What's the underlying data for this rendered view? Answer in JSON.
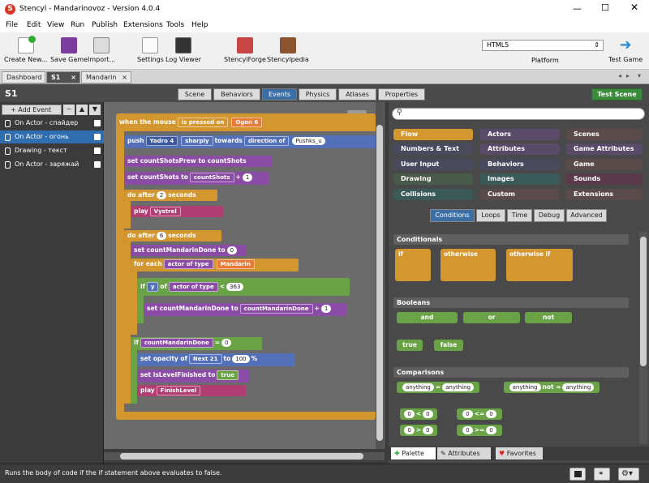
{
  "window": {
    "title": "Stencyl - Mandarinovoz - Version 4.0.4"
  },
  "menu": [
    "File",
    "Edit",
    "View",
    "Run",
    "Publish",
    "Extensions",
    "Tools",
    "Help"
  ],
  "toolbar": {
    "create_new": "Create New...",
    "save_game": "Save Game",
    "import": "Import...",
    "settings": "Settings",
    "log_viewer": "Log Viewer",
    "stencylforge": "StencylForge",
    "stencylpedia": "Stencylpedia",
    "platform_value": "HTML5",
    "platform_label": "Platform",
    "test_game": "Test Game"
  },
  "tabs": {
    "dashboard": "Dashboard",
    "s1": "S1",
    "mandarin": "Mandarin"
  },
  "scene_title": "S1",
  "modes": [
    "Scene",
    "Behaviors",
    "Events",
    "Physics",
    "Atlases",
    "Properties"
  ],
  "test_scene": "Test Scene",
  "events": {
    "add_event": "+ Add Event",
    "items": [
      "On Actor - спайдер",
      "On Actor - огонь",
      "Drawing - текст",
      "On Actor - заряжай"
    ]
  },
  "blocks": {
    "when_pressed": [
      "when the mouse",
      "is pressed on",
      "Ogon 6"
    ],
    "push": [
      "push",
      "Yadro 4",
      "sharply",
      "towards",
      "direction of",
      "Pushks_u"
    ],
    "set1": [
      "set countShotsPrew to",
      "countShots"
    ],
    "set2": [
      "set countShots to",
      "countShots",
      "+",
      "1"
    ],
    "do_after1": [
      "do after",
      "2",
      "seconds"
    ],
    "play1": [
      "play",
      "Vystrel"
    ],
    "do_after2": [
      "do after",
      "6",
      "seconds"
    ],
    "set3": [
      "set countMandarinDone to",
      "0"
    ],
    "for_each": [
      "for each",
      "actor of type",
      "Mandarin"
    ],
    "if1": [
      "if",
      "y",
      "of",
      "actor of type",
      "<",
      "363"
    ],
    "set4": [
      "set countMandarinDone to",
      "countMandarinDone",
      "+",
      "1"
    ],
    "if2": [
      "if",
      "countMandarinDone",
      "=",
      "0"
    ],
    "opacity": [
      "set opacity of",
      "Next 21",
      "to",
      "100",
      "%"
    ],
    "level": [
      "set isLevelFinished to",
      "true"
    ],
    "play2": [
      "play",
      "FinishLevel"
    ]
  },
  "palette": {
    "search_placeholder": "",
    "categories": [
      "Flow",
      "Actors",
      "Scenes",
      "Numbers & Text",
      "Attributes",
      "Game Attributes",
      "User Input",
      "Behaviors",
      "Game",
      "Drawing",
      "Images",
      "Sounds",
      "Collisions",
      "Custom",
      "Extensions"
    ],
    "subtabs": [
      "Conditions",
      "Loops",
      "Time",
      "Debug",
      "Advanced"
    ],
    "conditionals": {
      "title": "Conditionals",
      "if": "if",
      "otherwise": "otherwise",
      "otherwise_if": "otherwise if"
    },
    "booleans": {
      "title": "Booleans",
      "and": "and",
      "or": "or",
      "not": "not",
      "true": "true",
      "false": "false"
    },
    "comparisons": {
      "title": "Comparisons",
      "any1": "anything",
      "eq": "=",
      "any2": "anything",
      "any3": "anything",
      "neq": "not =",
      "any4": "anything",
      "lt": [
        "0",
        "<",
        "0"
      ],
      "le": [
        "0",
        "<=",
        "0"
      ],
      "gt": [
        "0",
        ">",
        "0"
      ],
      "ge": [
        "0",
        ">=",
        "0"
      ]
    },
    "bottom_tabs": [
      "Palette",
      "Attributes",
      "Favorites"
    ]
  },
  "status": "Runs the body of code if the if statement above evaluates to false.",
  "colors": {
    "flow": "#d4962e",
    "numbers": "#5470b8",
    "actor": "#8b4ca5",
    "sound": "#b03e72",
    "boolean": "#6aa345",
    "selected": "#2f6fb0"
  }
}
